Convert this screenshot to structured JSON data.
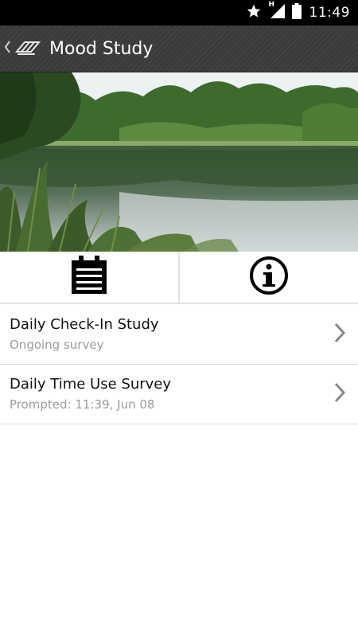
{
  "status_bar": {
    "time": "11:49",
    "icons": [
      "star-icon",
      "hspa-signal-icon",
      "battery-icon"
    ],
    "network_label": "H"
  },
  "action_bar": {
    "title": "Mood Study",
    "background_color": "#3a3a3a"
  },
  "header_image": {
    "description_icon": "lake-photo"
  },
  "tabs": [
    {
      "icon": "calendar-icon"
    },
    {
      "icon": "info-icon"
    }
  ],
  "surveys": [
    {
      "title": "Daily Check-In Study",
      "subtitle": "Ongoing survey"
    },
    {
      "title": "Daily Time Use Survey",
      "subtitle": "Prompted: 11:39, Jun 08"
    }
  ],
  "colors": {
    "subtitle": "#9b9b9b",
    "divider": "#dcdcdc",
    "chevron": "#8a8a8a"
  }
}
